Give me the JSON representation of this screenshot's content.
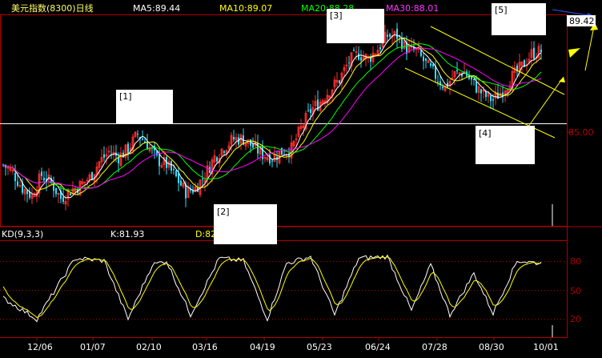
{
  "header": {
    "title": "美元指数(8300)日线",
    "ma5": "MA5:89.44",
    "ma10": "MA10:89.07",
    "ma20": "MA20:88.28",
    "ma30": "MA30:88.01"
  },
  "price_panel": {
    "current_price_tag": "89.42",
    "level_label": "85.00"
  },
  "kd_panel": {
    "title": "KD(9,3,3)",
    "k": "K:81.93",
    "d": "D:82",
    "tick_labels": [
      "80",
      "50",
      "20"
    ]
  },
  "annotations": [
    "[1]",
    "[2]",
    "[3]",
    "[4]",
    "[5]"
  ],
  "x_labels": [
    "12/06",
    "01/07",
    "02/10",
    "03/16",
    "04/19",
    "05/23",
    "06/24",
    "07/28",
    "08/30",
    "10/01"
  ],
  "colors": {
    "background": "#000000",
    "axis": "#b00000",
    "candle_up": "#ff3030",
    "candle_down": "#30e0ff",
    "ma5": "#ffffff",
    "ma10": "#ffff00",
    "ma20": "#00ff00",
    "ma30": "#ff00ff",
    "k_line": "#ffffff",
    "d_line": "#ffff00",
    "channel": "#ffff00",
    "tag_bg": "#ffffff"
  },
  "chart_data": {
    "type": "candlestick",
    "title": "美元指数(8300)日线",
    "timeframe": "daily",
    "x_categories": [
      "12/06",
      "01/07",
      "02/10",
      "03/16",
      "04/19",
      "05/23",
      "06/24",
      "07/28",
      "08/30",
      "10/01"
    ],
    "close_path": [
      [
        0,
        82.6
      ],
      [
        4,
        82.0
      ],
      [
        8,
        80.8
      ],
      [
        12,
        80.2
      ],
      [
        16,
        81.8
      ],
      [
        20,
        81.2
      ],
      [
        24,
        80.0
      ],
      [
        28,
        80.6
      ],
      [
        32,
        81.0
      ],
      [
        36,
        81.6
      ],
      [
        40,
        82.8
      ],
      [
        44,
        83.6
      ],
      [
        48,
        83.2
      ],
      [
        52,
        83.8
      ],
      [
        56,
        85.0
      ],
      [
        60,
        84.2
      ],
      [
        64,
        83.0
      ],
      [
        68,
        82.6
      ],
      [
        72,
        81.6
      ],
      [
        76,
        80.5
      ],
      [
        80,
        80.8
      ],
      [
        84,
        81.8
      ],
      [
        88,
        83.2
      ],
      [
        92,
        84.0
      ],
      [
        96,
        84.6
      ],
      [
        100,
        84.6
      ],
      [
        104,
        84.0
      ],
      [
        108,
        83.4
      ],
      [
        112,
        83.2
      ],
      [
        116,
        83.6
      ],
      [
        120,
        83.8
      ],
      [
        124,
        85.4
      ],
      [
        128,
        86.8
      ],
      [
        132,
        87.5
      ],
      [
        136,
        88.4
      ],
      [
        140,
        89.2
      ],
      [
        144,
        90.6
      ],
      [
        148,
        91.2
      ],
      [
        152,
        90.8
      ],
      [
        156,
        91.6
      ],
      [
        160,
        92.6
      ],
      [
        164,
        92.6
      ],
      [
        168,
        91.6
      ],
      [
        172,
        91.4
      ],
      [
        176,
        90.4
      ],
      [
        180,
        89.5
      ],
      [
        184,
        88.6
      ],
      [
        188,
        89.6
      ],
      [
        192,
        89.8
      ],
      [
        196,
        88.8
      ],
      [
        200,
        88.0
      ],
      [
        204,
        87.6
      ],
      [
        208,
        88.4
      ],
      [
        212,
        89.4
      ],
      [
        216,
        90.2
      ],
      [
        220,
        91.2
      ],
      [
        224,
        91.4
      ]
    ],
    "moving_averages": [
      {
        "name": "MA5",
        "value": 89.44
      },
      {
        "name": "MA10",
        "value": 89.07
      },
      {
        "name": "MA20",
        "value": 88.28
      },
      {
        "name": "MA30",
        "value": 88.01
      }
    ],
    "last_price": 89.42,
    "horizontal_level": 85.0,
    "indicator": {
      "name": "KD(9,3,3)",
      "K": 81.93,
      "D": 82,
      "y_ticks": [
        20,
        50,
        80
      ],
      "ylim": [
        0,
        100
      ]
    }
  }
}
